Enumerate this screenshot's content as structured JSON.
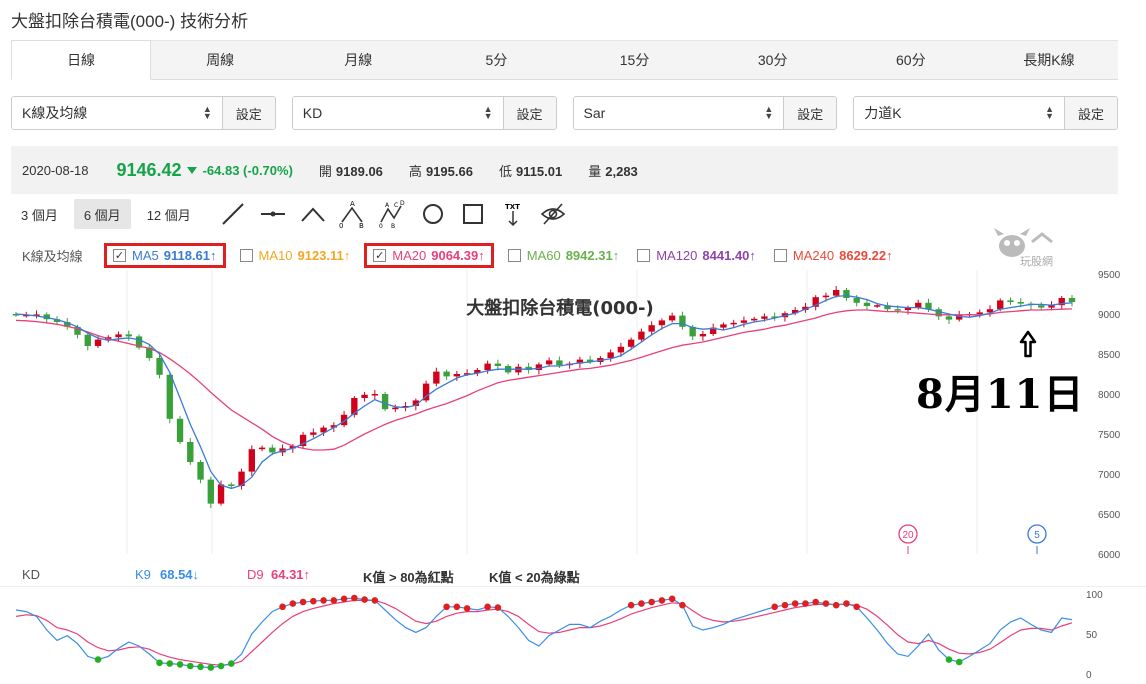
{
  "page": {
    "title": "大盤扣除台積電(000-) 技術分析"
  },
  "tabs": [
    {
      "label": "日線",
      "active": true
    },
    {
      "label": "周線"
    },
    {
      "label": "月線"
    },
    {
      "label": "5分"
    },
    {
      "label": "15分"
    },
    {
      "label": "30分"
    },
    {
      "label": "60分"
    },
    {
      "label": "長期K線"
    }
  ],
  "selectors": [
    {
      "value": "K線及均線",
      "button": "設定"
    },
    {
      "value": "KD",
      "button": "設定"
    },
    {
      "value": "Sar",
      "button": "設定"
    },
    {
      "value": "力道K",
      "button": "設定"
    }
  ],
  "quote": {
    "date": "2020-08-18",
    "price": "9146.42",
    "change": "-64.83 (-0.70%)",
    "open_label": "開",
    "open": "9189.06",
    "high_label": "高",
    "high": "9195.66",
    "low_label": "低",
    "low": "9115.01",
    "volume_label": "量",
    "volume": "2,283",
    "down_color": "#16a34a"
  },
  "ranges": [
    {
      "label": "3 個月"
    },
    {
      "label": "6 個月",
      "active": true
    },
    {
      "label": "12 個月"
    }
  ],
  "tools": [
    "line-tool-icon",
    "horizontal-line-icon",
    "angle-icon",
    "abc-pattern-icon",
    "abcd-pattern-icon",
    "circle-icon",
    "rectangle-icon",
    "text-tool-icon",
    "hide-icon"
  ],
  "ma_legend": {
    "title": "K線及均線",
    "items": [
      {
        "label": "MA5",
        "value": "9118.61↑",
        "color": "#3a7bd5",
        "checked": true,
        "highlight": true
      },
      {
        "label": "MA10",
        "value": "9123.11↑",
        "color": "#f5a623",
        "checked": false
      },
      {
        "label": "MA20",
        "value": "9064.39↑",
        "color": "#e8407a",
        "checked": true,
        "highlight": true
      },
      {
        "label": "MA60",
        "value": "8942.31↑",
        "color": "#6ab04c",
        "checked": false
      },
      {
        "label": "MA120",
        "value": "8441.40↑",
        "color": "#8e44ad",
        "checked": false
      },
      {
        "label": "MA240",
        "value": "8629.22↑",
        "color": "#e74c3c",
        "checked": false
      }
    ]
  },
  "chart_watermark": "大盤扣除台積電(000-)",
  "annotation": {
    "text": "8月11日"
  },
  "markers": [
    {
      "label": "20"
    },
    {
      "label": "5"
    }
  ],
  "logo_text": "玩股網",
  "kd_legend": {
    "title": "KD",
    "k_label": "K9",
    "k_value": "68.54↓",
    "d_label": "D9",
    "d_value": "64.31↑",
    "note1": "K值 > 80為紅點",
    "note2": "K值 < 20為綠點"
  },
  "chart_data": [
    {
      "type": "candlestick",
      "title": "大盤扣除台積電(000-)",
      "ylim": [
        6000,
        9500
      ],
      "yticks": [
        6000,
        6500,
        7000,
        7500,
        8000,
        8500,
        9000,
        9500
      ],
      "up_color": "#d0021b",
      "down_color": "#3aa03a",
      "ma5_color": "#3a7bd5",
      "ma20_color": "#e8407a",
      "close": [
        8990,
        8990,
        8995,
        8935,
        8900,
        8840,
        8740,
        8600,
        8680,
        8710,
        8745,
        8720,
        8580,
        8450,
        8240,
        7690,
        7400,
        7150,
        6930,
        6630,
        6870,
        6850,
        7030,
        7310,
        7330,
        7270,
        7320,
        7350,
        7490,
        7520,
        7580,
        7610,
        7740,
        7950,
        7990,
        8000,
        7810,
        7830,
        7850,
        7920,
        8130,
        8280,
        8220,
        8250,
        8260,
        8300,
        8380,
        8350,
        8270,
        8340,
        8300,
        8370,
        8420,
        8360,
        8380,
        8430,
        8400,
        8450,
        8520,
        8590,
        8680,
        8780,
        8860,
        8920,
        8980,
        8840,
        8720,
        8750,
        8830,
        8870,
        8890,
        8920,
        8940,
        8970,
        8960,
        9010,
        9050,
        9090,
        9210,
        9230,
        9300,
        9200,
        9140,
        9100,
        9110,
        9060,
        9050,
        9080,
        9140,
        9060,
        8970,
        8930,
        8990,
        9000,
        9020,
        9060,
        9170,
        9150,
        9130,
        9110,
        9080,
        9110,
        9200,
        9150
      ],
      "ma5": [
        9000,
        8990,
        8975,
        8955,
        8930,
        8890,
        8840,
        8760,
        8700,
        8670,
        8690,
        8700,
        8680,
        8620,
        8500,
        8270,
        7950,
        7620,
        7340,
        7030,
        6860,
        6820,
        6860,
        6960,
        7150,
        7250,
        7290,
        7320,
        7380,
        7440,
        7510,
        7580,
        7660,
        7760,
        7850,
        7930,
        7880,
        7840,
        7830,
        7860,
        7970,
        8060,
        8130,
        8200,
        8240,
        8260,
        8290,
        8310,
        8310,
        8310,
        8310,
        8320,
        8350,
        8350,
        8370,
        8390,
        8400,
        8420,
        8440,
        8480,
        8560,
        8650,
        8740,
        8820,
        8880,
        8880,
        8830,
        8810,
        8820,
        8800,
        8830,
        8870,
        8900,
        8920,
        8950,
        8980,
        9010,
        9060,
        9110,
        9170,
        9220,
        9230,
        9210,
        9180,
        9130,
        9100,
        9090,
        9080,
        9080,
        9060,
        9030,
        9000,
        8970,
        8960,
        8980,
        9010,
        9060,
        9080,
        9100,
        9120,
        9120,
        9110,
        9130,
        9140
      ],
      "ma20": [
        8920,
        8915,
        8905,
        8890,
        8870,
        8845,
        8815,
        8775,
        8730,
        8690,
        8660,
        8630,
        8600,
        8570,
        8520,
        8440,
        8350,
        8250,
        8140,
        8020,
        7910,
        7800,
        7720,
        7640,
        7560,
        7470,
        7400,
        7350,
        7320,
        7300,
        7300,
        7310,
        7360,
        7430,
        7500,
        7560,
        7620,
        7670,
        7710,
        7750,
        7800,
        7840,
        7880,
        7930,
        7980,
        8040,
        8090,
        8140,
        8170,
        8190,
        8210,
        8230,
        8250,
        8270,
        8290,
        8310,
        8320,
        8340,
        8360,
        8390,
        8420,
        8460,
        8500,
        8540,
        8580,
        8610,
        8630,
        8650,
        8680,
        8710,
        8740,
        8770,
        8790,
        8810,
        8840,
        8860,
        8890,
        8920,
        8950,
        8990,
        9020,
        9040,
        9050,
        9050,
        9040,
        9030,
        9030,
        9020,
        9010,
        9000,
        8990,
        8990,
        8990,
        8990,
        8990,
        9000,
        9020,
        9030,
        9040,
        9050,
        9050,
        9055,
        9060,
        9064
      ]
    },
    {
      "type": "line",
      "title": "KD",
      "ylim": [
        0,
        100
      ],
      "yticks": [
        0,
        50,
        100
      ],
      "k_color": "#3a8ee6",
      "d_color": "#e8407a",
      "dot_high_color": "#e02020",
      "dot_low_color": "#22b022",
      "k": [
        80,
        78,
        72,
        55,
        42,
        48,
        38,
        22,
        18,
        22,
        32,
        40,
        35,
        25,
        14,
        13,
        12,
        10,
        9,
        8,
        10,
        13,
        25,
        50,
        65,
        78,
        84,
        88,
        90,
        91,
        92,
        92,
        94,
        95,
        93,
        92,
        80,
        68,
        58,
        52,
        58,
        72,
        84,
        84,
        82,
        80,
        84,
        83,
        72,
        58,
        42,
        35,
        48,
        55,
        62,
        62,
        58,
        66,
        72,
        80,
        86,
        88,
        90,
        92,
        94,
        86,
        60,
        55,
        58,
        62,
        68,
        72,
        76,
        80,
        84,
        86,
        88,
        88,
        90,
        88,
        86,
        88,
        84,
        70,
        55,
        38,
        25,
        22,
        35,
        50,
        30,
        18,
        15,
        22,
        30,
        38,
        55,
        65,
        70,
        62,
        55,
        52,
        70,
        68
      ],
      "d": [
        72,
        74,
        73,
        67,
        58,
        55,
        50,
        40,
        33,
        29,
        30,
        33,
        34,
        31,
        25,
        21,
        18,
        16,
        14,
        12,
        11,
        12,
        16,
        28,
        40,
        52,
        63,
        72,
        78,
        82,
        85,
        88,
        90,
        92,
        92,
        92,
        88,
        82,
        74,
        66,
        63,
        66,
        72,
        76,
        78,
        78,
        80,
        81,
        78,
        72,
        62,
        53,
        51,
        52,
        55,
        58,
        58,
        60,
        64,
        69,
        75,
        79,
        83,
        86,
        89,
        88,
        79,
        71,
        67,
        65,
        66,
        68,
        71,
        74,
        77,
        80,
        83,
        85,
        87,
        87,
        87,
        87,
        86,
        81,
        72,
        61,
        49,
        40,
        38,
        42,
        38,
        31,
        26,
        25,
        27,
        31,
        39,
        48,
        55,
        57,
        57,
        55,
        60,
        64
      ]
    }
  ]
}
